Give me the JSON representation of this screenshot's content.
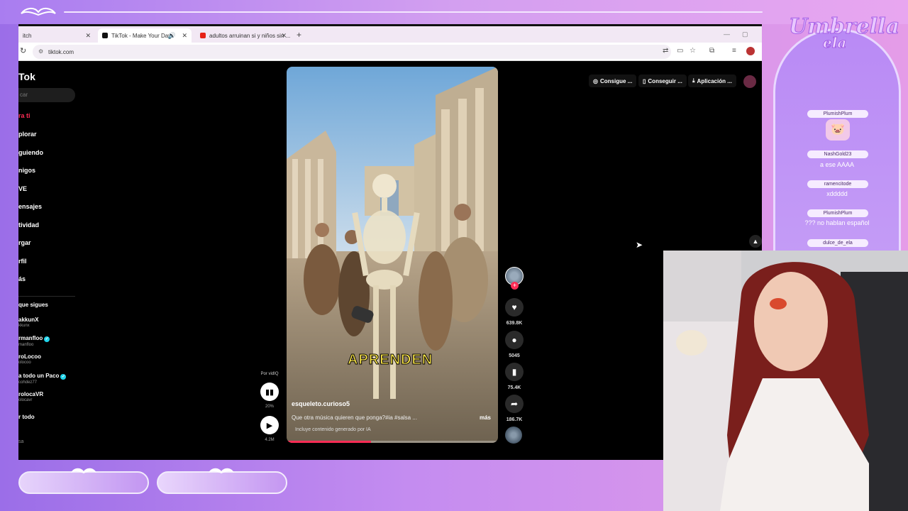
{
  "browser": {
    "tabs": [
      {
        "label": "itch",
        "active": false
      },
      {
        "label": "TikTok - Make Your Day",
        "active": true
      },
      {
        "label": "adultos arruinan si y niños sin ...",
        "active": false
      }
    ],
    "url": "tiktok.com"
  },
  "tiktok": {
    "logo": "Tok",
    "search_placeholder": "car",
    "nav": [
      "ra ti",
      "plorar",
      "guiendo",
      "nigos",
      "VE",
      "ensajes",
      "tividad",
      "rgar",
      "rfil",
      "ás"
    ],
    "following_title": "que sigues",
    "accounts": [
      {
        "name": "akkunX",
        "handle": "kkunx"
      },
      {
        "name": "rmanfloo",
        "handle": "manfloo"
      },
      {
        "name": "roLocoo",
        "handle": "olocoo"
      },
      {
        "name": "a todo un Paco",
        "handle": "cohdez77"
      },
      {
        "name": "rolocaVR",
        "handle": "olocavr"
      }
    ],
    "see_all": "r todo",
    "footer": "sa",
    "top_buttons": [
      "Consigue ...",
      "Conseguir ...",
      "Aplicación ..."
    ],
    "video": {
      "caption": "APRENDEN",
      "author": "esqueleto.curioso5",
      "description": "Que otra música quieren que ponga?#ia #salsa ...",
      "more": "más",
      "ai_label": "Incluye contenido generado por IA",
      "progress": 0.4
    },
    "left_controls": {
      "by_label": "Por vidIQ",
      "percent": "20%",
      "views": "4.2M"
    },
    "actions": {
      "likes": "639.8K",
      "comments": "5045",
      "saves": "75.4K",
      "shares": "186.7K"
    }
  },
  "chat": {
    "brand_line1": "Umbrella",
    "brand_line2": "ela",
    "messages": [
      {
        "user": "PlumishPlum",
        "text": ""
      },
      {
        "user": "NashGold23",
        "text": "a ese AAAA"
      },
      {
        "user": "ramencitode",
        "text": "xddddd"
      },
      {
        "user": "PlumishPlum",
        "text": "??? no hablan español"
      },
      {
        "user": "dulce_de_ela",
        "text": ""
      }
    ]
  }
}
